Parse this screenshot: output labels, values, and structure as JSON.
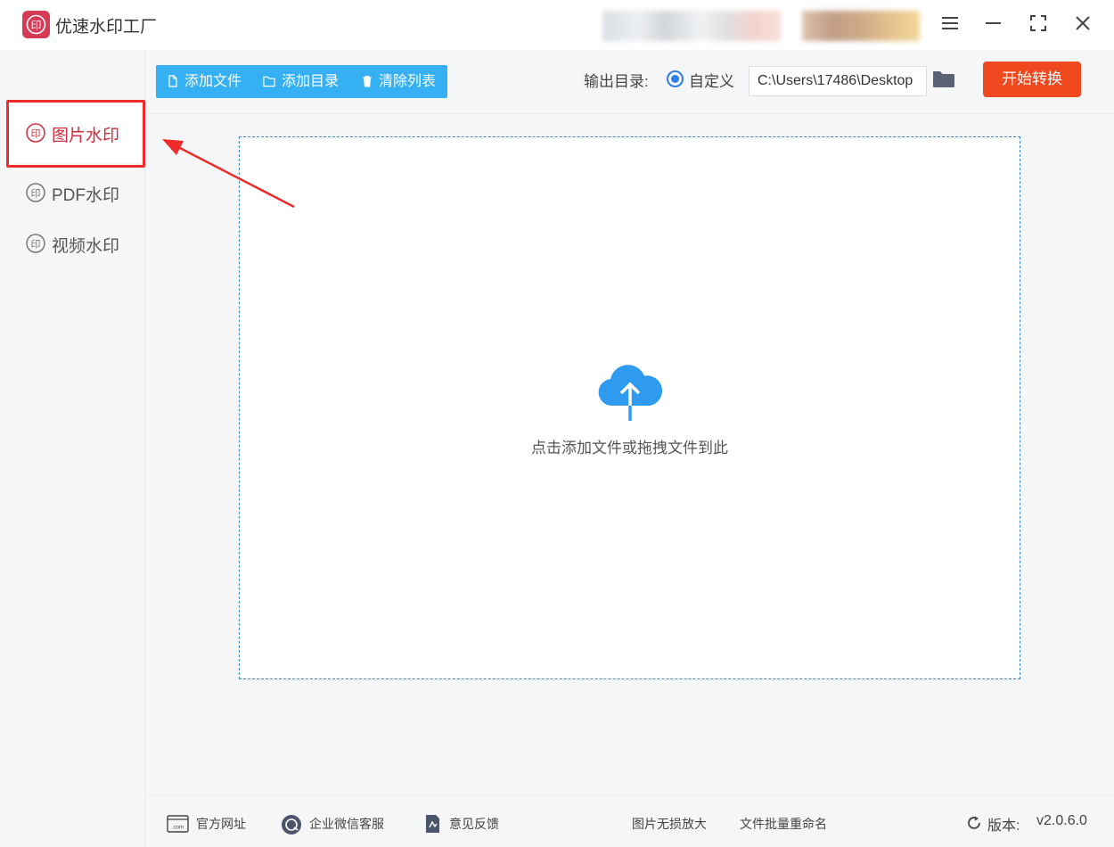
{
  "app": {
    "title": "优速水印工厂"
  },
  "window_controls": [
    "menu-icon",
    "minimize-icon",
    "maximize-icon",
    "close-icon"
  ],
  "sidebar": {
    "items": [
      {
        "label": "图片水印",
        "active": true,
        "icon": "watermark-stamp-icon"
      },
      {
        "label": "PDF水印",
        "active": false,
        "icon": "watermark-stamp-icon"
      },
      {
        "label": "视频水印",
        "active": false,
        "icon": "watermark-stamp-icon"
      }
    ]
  },
  "toolbar": {
    "add_file": "添加文件",
    "add_dir": "添加目录",
    "clear_list": "清除列表",
    "output_label": "输出目录:",
    "radio_custom": "自定义",
    "output_path": "C:\\Users\\17486\\Desktop",
    "start": "开始转换"
  },
  "dropzone": {
    "hint": "点击添加文件或拖拽文件到此",
    "icon": "cloud-upload-icon"
  },
  "footer": {
    "website": "官方网址",
    "wechat_support": "企业微信客服",
    "feedback": "意见反馈",
    "lossless_enlarge": "图片无损放大",
    "batch_rename": "文件批量重命名",
    "version_label": "版本:",
    "version": "v2.0.6.0"
  },
  "colors": {
    "accent_blue": "#35b0f3",
    "start_orange": "#f0481f",
    "active_red": "#cf2e3e",
    "highlight_red": "#ee2b2b",
    "logo": "#d63a55"
  }
}
